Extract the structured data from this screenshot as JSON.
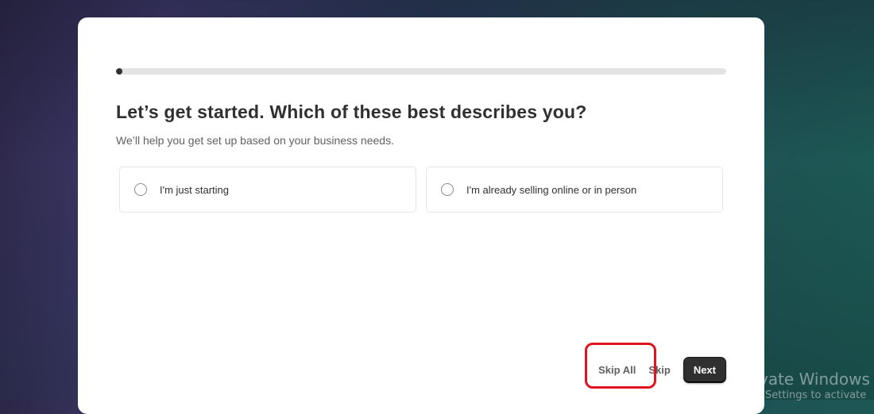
{
  "onboarding": {
    "progress_percent": 1,
    "title": "Let’s get started. Which of these best describes you?",
    "subtitle": "We’ll help you get set up based on your business needs.",
    "options": [
      {
        "label": "I'm just starting",
        "selected": false
      },
      {
        "label": "I'm already selling online or in person",
        "selected": false
      }
    ],
    "footer": {
      "skip_all_label": "Skip All",
      "skip_label": "Skip",
      "next_label": "Next"
    }
  },
  "annotation": {
    "highlight_target": "Skip All",
    "highlight_color": "#e0141f"
  },
  "watermark": {
    "title": "vate Windows",
    "subtitle": "Settings to activate"
  },
  "colors": {
    "primary_button": "#303030",
    "progress_fill": "#303030",
    "progress_track": "#e3e3e3"
  }
}
